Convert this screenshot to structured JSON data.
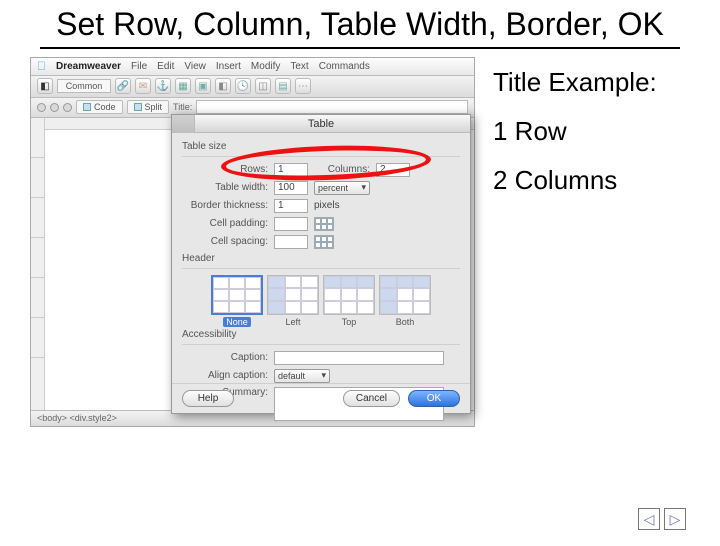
{
  "slide": {
    "title": "Set Row, Column, Table Width, Border, OK"
  },
  "mac_menubar": {
    "app": "Dreamweaver",
    "items": [
      "File",
      "Edit",
      "View",
      "Insert",
      "Modify",
      "Text",
      "Commands"
    ]
  },
  "insert_toolbar": {
    "category": "Common"
  },
  "doc_toolbar": {
    "view_code": "Code",
    "view_split": "Split",
    "title_label": "Title:"
  },
  "dialog": {
    "title": "Table",
    "section_size": "Table size",
    "rows_label": "Rows:",
    "rows_value": "1",
    "columns_label": "Columns:",
    "columns_value": "2",
    "width_label": "Table width:",
    "width_value": "100",
    "width_unit": "percent",
    "border_label": "Border thickness:",
    "border_value": "1",
    "border_unit": "pixels",
    "padding_label": "Cell padding:",
    "spacing_label": "Cell spacing:",
    "section_header": "Header",
    "header_options": [
      "None",
      "Left",
      "Top",
      "Both"
    ],
    "section_access": "Accessibility",
    "caption_label": "Caption:",
    "align_label": "Align caption:",
    "align_value": "default",
    "summary_label": "Summary:",
    "help": "Help",
    "cancel": "Cancel",
    "ok": "OK"
  },
  "statusbar": {
    "text": "<body> <div.style2>"
  },
  "side": {
    "title_example": "Title Example:",
    "row_text": "1 Row",
    "col_text": "2 Columns"
  },
  "nav": {
    "prev": "◁",
    "next": "▷"
  }
}
